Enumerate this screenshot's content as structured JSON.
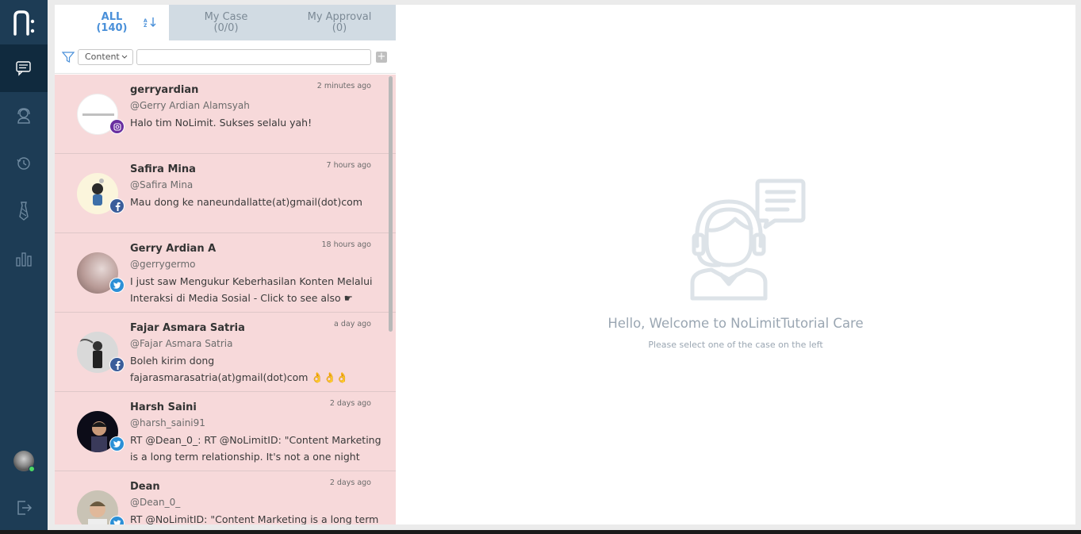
{
  "app": {
    "brand_color": "#1d3c55",
    "accent_color": "#4a90d9"
  },
  "nav": {
    "items": [
      {
        "icon": "chat-icon",
        "active": true
      },
      {
        "icon": "agent-icon",
        "active": false
      },
      {
        "icon": "history-icon",
        "active": false
      },
      {
        "icon": "tie-icon",
        "active": false
      },
      {
        "icon": "bar-chart-icon",
        "active": false
      }
    ],
    "bottom": [
      {
        "icon": "avatar"
      },
      {
        "icon": "logout-icon"
      }
    ]
  },
  "tabs": {
    "all": {
      "label": "ALL",
      "count": "(140)"
    },
    "mine": {
      "label": "My Case",
      "count": "(0/0)"
    },
    "approval": {
      "label": "My Approval",
      "count": "(0)"
    }
  },
  "filter": {
    "select_value": "Content",
    "search_value": ""
  },
  "cases": [
    {
      "name": "gerryardian",
      "handle": "@Gerry Ardian Alamsyah",
      "message": "Halo tim NoLimit. Sukses selalu yah!",
      "time": "2 minutes ago",
      "platform": "instagram"
    },
    {
      "name": "Safira Mina",
      "handle": "@Safira Mina",
      "message": "Mau dong ke naneundallatte(at)gmail(dot)com",
      "time": "7 hours ago",
      "platform": "facebook"
    },
    {
      "name": "Gerry Ardian A",
      "handle": "@gerrygermo",
      "message": "I just saw Mengukur Keberhasilan Konten Melalui Interaksi di Media Sosial - Click to see also ☛",
      "time": "18 hours ago",
      "platform": "twitter"
    },
    {
      "name": "Fajar Asmara Satria",
      "handle": "@Fajar Asmara Satria",
      "message": "Boleh kirim dong fajarasmarasatria(at)gmail(dot)com 👌👌👌",
      "time": "a day ago",
      "platform": "facebook"
    },
    {
      "name": "Harsh Saini",
      "handle": "@harsh_saini91",
      "message": "RT @Dean_0_: RT @NoLimitID: \"Content Marketing is a long term relationship. It's not a one night",
      "time": "2 days ago",
      "platform": "twitter"
    },
    {
      "name": "Dean",
      "handle": "@Dean_0_",
      "message": "RT @NoLimitID: \"Content Marketing is a long term relationship.",
      "time": "2 days ago",
      "platform": "twitter"
    }
  ],
  "detail": {
    "welcome": "Hello, Welcome to NoLimitTutorial Care",
    "subtitle": "Please select one of the case on the left"
  }
}
